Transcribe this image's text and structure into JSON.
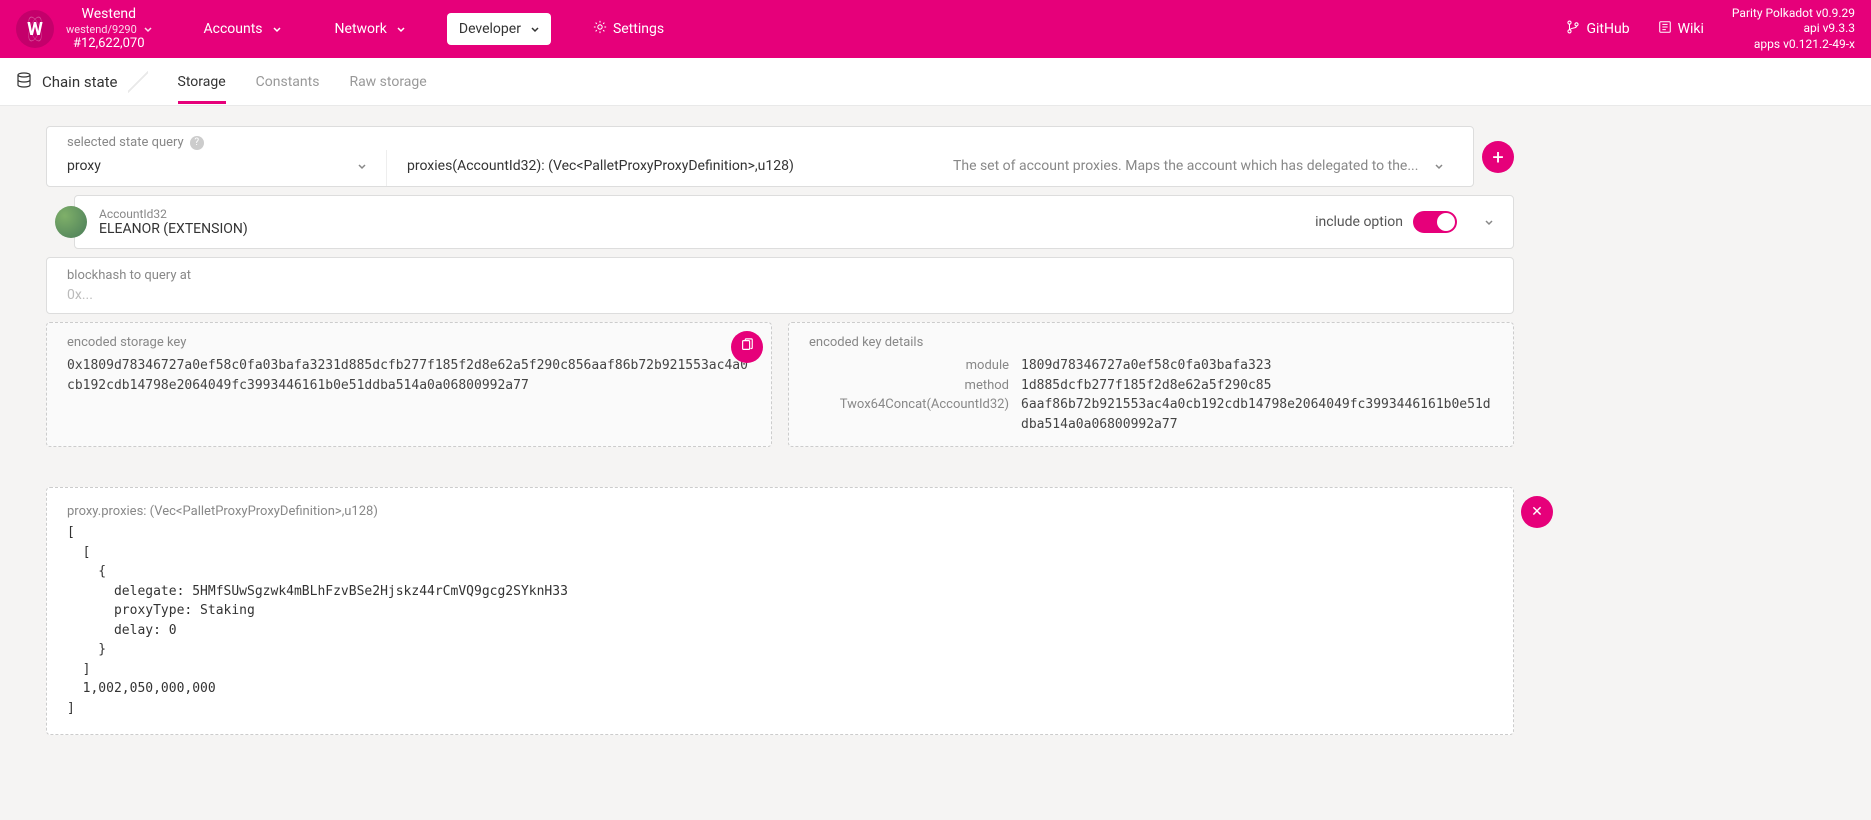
{
  "topbar": {
    "logo_letter": "W",
    "network_name": "Westend",
    "network_sub": "westend/9290",
    "block_num": "#12,622,070",
    "nav": {
      "accounts": "Accounts",
      "network": "Network",
      "developer": "Developer",
      "settings": "Settings"
    },
    "links": {
      "github": "GitHub",
      "wiki": "Wiki"
    },
    "versions": {
      "line1": "Parity Polkadot v0.9.29",
      "line2": "api v9.3.3",
      "line3": "apps v0.121.2-49-x"
    }
  },
  "subbar": {
    "title": "Chain state",
    "tabs": {
      "storage": "Storage",
      "constants": "Constants",
      "raw": "Raw storage"
    }
  },
  "query": {
    "label": "selected state query",
    "module": "proxy",
    "method": "proxies(AccountId32): (Vec<PalletProxyProxyDefinition>,u128)",
    "description": "The set of account proxies. Maps the account which has delegated to the..."
  },
  "account": {
    "type_label": "AccountId32",
    "name": "ELEANOR (EXTENSION)",
    "include_label": "include option"
  },
  "blockhash": {
    "label": "blockhash to query at",
    "placeholder": "0x..."
  },
  "encoded_key": {
    "label": "encoded storage key",
    "value": "0x1809d78346727a0ef58c0fa03bafa3231d885dcfb277f185f2d8e62a5f290c856aaf86b72b921553ac4a0cb192cdb14798e2064049fc3993446161b0e51ddba514a0a06800992a77"
  },
  "key_details": {
    "label": "encoded key details",
    "rows": [
      {
        "k": "module",
        "v": "1809d78346727a0ef58c0fa03bafa323"
      },
      {
        "k": "method",
        "v": "1d885dcfb277f185f2d8e62a5f290c85"
      },
      {
        "k": "Twox64Concat(AccountId32)",
        "v": "6aaf86b72b921553ac4a0cb192cdb14798e2064049fc3993446161b0e51ddba514a0a06800992a77"
      }
    ]
  },
  "result": {
    "label": "proxy.proxies: (Vec<PalletProxyProxyDefinition>,u128)",
    "body": "[\n  [\n    {\n      delegate: 5HMfSUwSgzwk4mBLhFzvBSe2Hjskz44rCmVQ9gcg2SYknH33\n      proxyType: Staking\n      delay: 0\n    }\n  ]\n  1,002,050,000,000\n]"
  }
}
